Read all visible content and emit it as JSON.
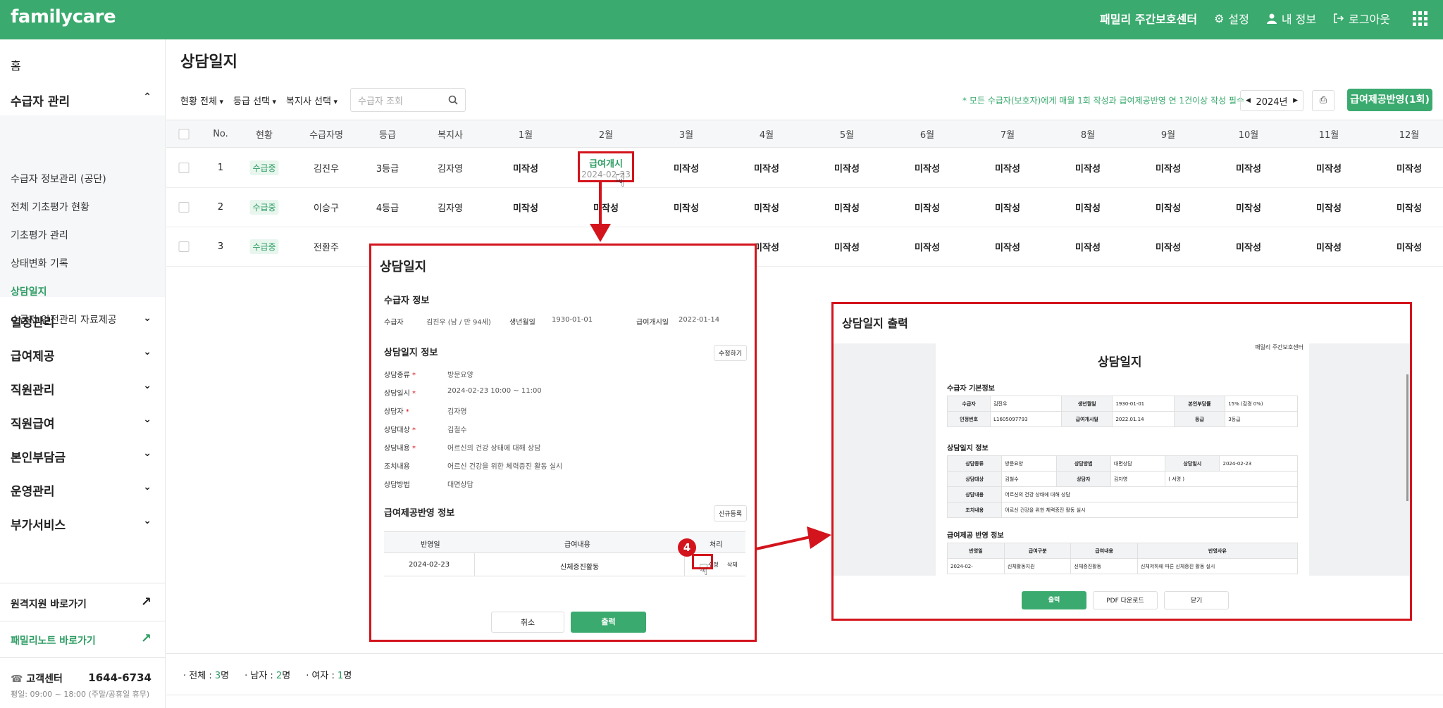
{
  "header": {
    "logo": "familycare",
    "center_name": "패밀리 주간보호센터",
    "settings_label": "설정",
    "myinfo_label": "내 정보",
    "logout_label": "로그아웃"
  },
  "sidebar": {
    "home": "홈",
    "group_recipient": "수급자 관리",
    "sub_items": [
      "수급자 정보관리 (공단)",
      "전체 기초평가 현황",
      "기초평가 관리",
      "상태변화 기록",
      "상담일지",
      "수급자 안전관리 자료제공"
    ],
    "groups": [
      "일정관리",
      "급여제공",
      "직원관리",
      "직원급여",
      "본인부담금",
      "운영관리",
      "부가서비스"
    ],
    "remote_link": "원격지원 바로가기",
    "familynote_link": "패밀리노트 바로가기",
    "support_label": "고객센터",
    "support_phone": "1644-6734",
    "support_hours": "평일: 09:00 ~ 18:00 (주말/공휴일 휴무)"
  },
  "main": {
    "title": "상담일지",
    "filters": {
      "status": "현황 전체",
      "grade": "등급 선택",
      "worker": "복지사 선택",
      "search_placeholder": "수급자 조회"
    },
    "notice": "* 모든 수급자(보호자)에게 매월 1회 작성과 급여제공반영 연 1건이상 작성 필수",
    "year": "2024년",
    "apply_button": "급여제공반영(1회)",
    "columns": [
      "No.",
      "현황",
      "수급자명",
      "등급",
      "복지사",
      "1월",
      "2월",
      "3월",
      "4월",
      "5월",
      "6월",
      "7월",
      "8월",
      "9월",
      "10월",
      "11월",
      "12월"
    ],
    "rows": [
      {
        "no": "1",
        "status": "수급중",
        "name": "김진우",
        "grade": "3등급",
        "worker": "김자영"
      },
      {
        "no": "2",
        "status": "수급중",
        "name": "이승구",
        "grade": "4등급",
        "worker": "김자영"
      },
      {
        "no": "3",
        "status": "수급중",
        "name": "전환주",
        "grade": "",
        "worker": ""
      }
    ],
    "not_written": "미작성",
    "feb_label": "급여개시",
    "feb_date": "2024-02-23",
    "summary": {
      "total_label": "전체 :",
      "total_count": "3",
      "male_label": "남자 :",
      "male_count": "2",
      "female_label": "여자 :",
      "female_count": "1",
      "unit": "명"
    }
  },
  "modal1": {
    "title": "상담일지",
    "sec_recipient": "수급자 정보",
    "lbl_recipient": "수급자",
    "val_recipient": "김진우 (남 / 만 94세)",
    "lbl_birth": "생년월일",
    "val_birth": "1930-01-01",
    "lbl_start": "급여개시일",
    "val_start": "2022-01-14",
    "sec_log": "상담일지 정보",
    "edit_button": "수정하기",
    "fields": [
      {
        "label": "상담종류",
        "required": "*",
        "value": "방문요양"
      },
      {
        "label": "상담일시",
        "required": "*",
        "value": "2024-02-23 10:00 ~ 11:00"
      },
      {
        "label": "상담자",
        "required": "*",
        "value": "김자영"
      },
      {
        "label": "상담대상",
        "required": "*",
        "value": "김철수"
      },
      {
        "label": "상담내용",
        "required": "*",
        "value": "어르신의 건강 상태에 대해 상담"
      },
      {
        "label": "조치내용",
        "required": "",
        "value": "어르신 건강을 위한 체력증진 활동 실시"
      },
      {
        "label": "상담방법",
        "required": "",
        "value": "대면상담"
      }
    ],
    "sec_reflect": "급여제공반영 정보",
    "new_button": "신규등록",
    "tbl_headers": [
      "반영일",
      "급여내용",
      "처리"
    ],
    "tbl_row": {
      "date": "2024-02-23",
      "content": "신체증진활동",
      "edit": "수정",
      "delete": "삭제"
    },
    "cancel_button": "취소",
    "print_button": "출력"
  },
  "step_badge": "4",
  "modal2": {
    "title": "상담일지 출력",
    "doc_header": "패밀리 주간보호센터",
    "doc_title": "상담일지",
    "sec_basic": "수급자 기본정보",
    "basic_rows": [
      [
        "수급자",
        "김진우",
        "생년월일",
        "1930-01-01",
        "본인부담률",
        "15% (감경 0%)"
      ],
      [
        "인정번호",
        "L1605097793",
        "급여개시일",
        "2022.01.14",
        "등급",
        "3등급"
      ]
    ],
    "sec_log": "상담일지 정보",
    "log_row1": [
      "상담종류",
      "방문요양",
      "상담방법",
      "대면상담",
      "상담일시",
      "2024-02-23"
    ],
    "log_row2": [
      "상담대상",
      "김철수",
      "상담자",
      "김자영",
      "( 서명 )"
    ],
    "log_row3": [
      "상담내용",
      "어르신의 건강 상태에 대해 상담"
    ],
    "log_row4": [
      "조치내용",
      "어르신 건강을 위한 체력증진 활동 실시"
    ],
    "sec_reflect": "급여제공 반영 정보",
    "reflect_headers": [
      "반영일",
      "급여구분",
      "급여내용",
      "반영사유"
    ],
    "reflect_row": [
      "2024-02-",
      "신체활동지원",
      "신체증진활동",
      "신체저하에 따른 신체증진 활동 실시"
    ],
    "print_button": "출력",
    "pdf_button": "PDF 다운로드",
    "close_button": "닫기"
  },
  "colors": {
    "primary": "#3aaa6e",
    "annotation": "#d3141c"
  }
}
